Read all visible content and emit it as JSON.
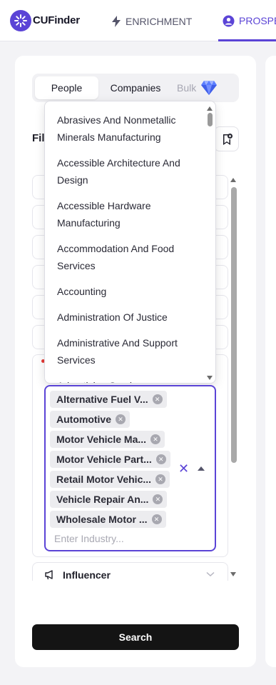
{
  "header": {
    "brand": "CUFinder",
    "nav": [
      {
        "label": "ENRICHMENT",
        "icon": "lightning-icon"
      },
      {
        "label": "PROSPE",
        "icon": "user-circle-icon"
      }
    ]
  },
  "tabs": {
    "people": "People",
    "companies": "Companies",
    "bulk": "Bulk"
  },
  "filter_label": "Fil",
  "industry_dropdown": {
    "options": [
      "Abrasives And Nonmetallic Minerals Manufacturing",
      "Accessible Architecture And Design",
      "Accessible Hardware Manufacturing",
      "Accommodation And Food Services",
      "Accounting",
      "Administration Of Justice",
      "Administrative And Support Services",
      "Advertising Services"
    ]
  },
  "industry_input": {
    "selected": [
      "Alternative Fuel V...",
      "Automotive",
      "Motor Vehicle Ma...",
      "Motor Vehicle Part...",
      "Retail Motor Vehic...",
      "Vehicle Repair An...",
      "Wholesale Motor ..."
    ],
    "placeholder": "Enter Industry..."
  },
  "influencer": {
    "label": "Influencer"
  },
  "search_button": "Search",
  "colors": {
    "accent": "#5b44d6",
    "button": "#141414",
    "bulk_gem": "#6c8cff"
  }
}
